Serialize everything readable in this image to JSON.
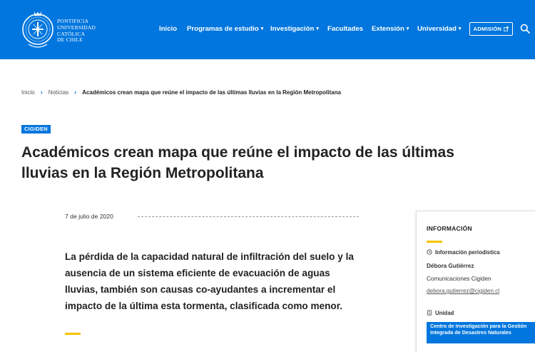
{
  "header": {
    "logo": {
      "lines": [
        "PONTIFICIA",
        "UNIVERSIDAD",
        "CATÓLICA",
        "DE CHILE"
      ]
    },
    "nav": [
      {
        "label": "Inicio",
        "dropdown": false
      },
      {
        "label": "Programas de estudio",
        "dropdown": true
      },
      {
        "label": "Investigación",
        "dropdown": true
      },
      {
        "label": "Facultades",
        "dropdown": false
      },
      {
        "label": "Extensión",
        "dropdown": true
      },
      {
        "label": "Universidad",
        "dropdown": true
      }
    ],
    "admision_label": "ADMISIÓN",
    "admision_icon": "external-link-icon",
    "search_icon": "search-icon",
    "bg_color": "#0176de"
  },
  "breadcrumb": {
    "items": [
      "Inicio",
      "Noticias"
    ],
    "current": "Académicos crean mapa que reúne el impacto de las últimas lluvias en la Región Metropolitana",
    "separator_icon": "chevron-right-icon"
  },
  "article": {
    "tag": "CIGIDEN",
    "title": "Académicos crean mapa que reúne el impacto de las últimas lluvias en la Región Metropolitana",
    "date": "7 de julio de 2020",
    "lead": "La pérdida de la capacidad natural de infiltración del suelo y la ausencia de un sistema eficiente de evacuación de aguas lluvias, también son causas co-ayudantes a incrementar el impacto de la última esta tormenta, clasificada como menor.",
    "accent_color": "#f5c400"
  },
  "info": {
    "title": "INFORMACIÓN",
    "press_label": "Información periodística",
    "press_icon": "clock-icon",
    "contact_name": "Débora Gutiérrez",
    "contact_org": "Comunicaciones Cigiden",
    "contact_email": "debora.gutierrez@cigiden.cl",
    "unit_label": "Unidad",
    "unit_icon": "building-icon",
    "unit_name": "Centro de Investigación para la Gestión Integrada de Desastres Naturales"
  }
}
